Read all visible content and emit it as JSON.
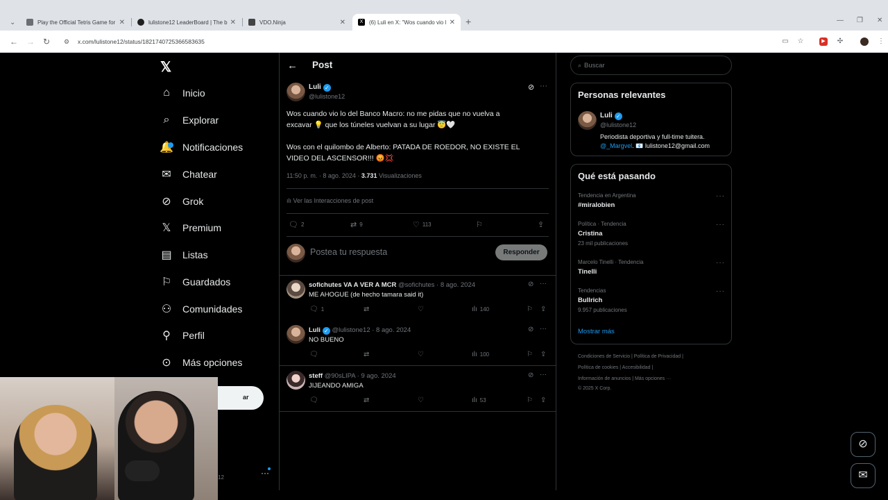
{
  "browser": {
    "tabs": [
      {
        "title": "Play the Official Tetris Game for",
        "color": "#6b6f73"
      },
      {
        "title": "lulistone12 LeaderBoard | The b",
        "color": "#1f1f1f"
      },
      {
        "title": "VDO.Ninja",
        "color": "#444"
      },
      {
        "title": "(6) Luli en X: \"Wos cuando vio l",
        "color": "#000"
      }
    ],
    "url": "x.com/lulistone12/status/1821740725366583635"
  },
  "nav": {
    "items": [
      {
        "label": "Inicio",
        "icon": "home-icon",
        "glyph": "⌂"
      },
      {
        "label": "Explorar",
        "icon": "search-icon",
        "glyph": "⌕"
      },
      {
        "label": "Notificaciones",
        "icon": "bell-icon",
        "glyph": "🔔"
      },
      {
        "label": "Chatear",
        "icon": "mail-icon",
        "glyph": "✉"
      },
      {
        "label": "Grok",
        "icon": "grok-icon",
        "glyph": "⊘"
      },
      {
        "label": "Premium",
        "icon": "x-icon",
        "glyph": "𝕏"
      },
      {
        "label": "Listas",
        "icon": "list-icon",
        "glyph": "▤"
      },
      {
        "label": "Guardados",
        "icon": "bookmark-icon",
        "glyph": "⚐"
      },
      {
        "label": "Comunidades",
        "icon": "people-icon",
        "glyph": "⚇"
      },
      {
        "label": "Perfil",
        "icon": "person-icon",
        "glyph": "⚲"
      },
      {
        "label": "Más opciones",
        "icon": "more-circle-icon",
        "glyph": "⊙"
      }
    ],
    "post_button": "ar",
    "partial_handle": "12"
  },
  "post": {
    "header_title": "Post",
    "author_name": "Luli",
    "author_handle": "@lulistone12",
    "text_line1": "Wos cuando vio lo del Banco Macro: no me pidas que no vuelva a",
    "text_line2": "excavar 💡 que los túneles vuelvan a su lugar 😇🤍",
    "text_line3": "Wos con el quilombo de Alberto: PATADA DE ROEDOR, NO EXISTE EL",
    "text_line4": "VIDEO DEL ASCENSOR!!! 😡💢",
    "time": "11:50 p. m. · 8 ago. 2024 ·",
    "views": "3.731",
    "views_label": "Visualizaciones",
    "interactions": "Ver las Interacciones de post",
    "replies": "2",
    "reposts": "9",
    "likes": "113",
    "reply_placeholder": "Postea tu respuesta",
    "reply_button": "Responder"
  },
  "replies": [
    {
      "name": "sofichutes VA A VER A MCR",
      "handle": "@sofichutes · 8 ago. 2024",
      "text": "ME AHOGUE (de hecho tamara said it)",
      "replies": "1",
      "views": "140"
    },
    {
      "name": "Luli",
      "handle": "@lulistone12 · 8 ago. 2024",
      "text": "NO BUENO",
      "replies": "",
      "views": "100"
    },
    {
      "name": "steff",
      "handle": "@90sLIPA · 9 ago. 2024",
      "text": "JIJEANDO AMIGA",
      "replies": "",
      "views": "53"
    }
  ],
  "sidebar": {
    "search_placeholder": "Buscar",
    "relevant_title": "Personas relevantes",
    "rel_name": "Luli",
    "rel_handle": "@lulistone12",
    "rel_bio1": "Periodista deportiva y full-time tuitera.",
    "rel_bio_link": "@_Margvel",
    "rel_bio2": ". 📧 lulistone12@gmail.com",
    "trending_title": "Qué está pasando",
    "trends": [
      {
        "meta": "Tendencia en Argentina",
        "name": "#miralobien",
        "count": ""
      },
      {
        "meta": "Política · Tendencia",
        "name": "Cristina",
        "count": "23 mil publicaciones"
      },
      {
        "meta": "Marcelo Tinelli · Tendencia",
        "name": "Tinelli",
        "count": ""
      },
      {
        "meta": "Tendencias",
        "name": "Bullrich",
        "count": "9.957 publicaciones"
      }
    ],
    "show_more": "Mostrar más",
    "footer1": "Condiciones de Servicio  |   Política de Privacidad  |",
    "footer2": "Política de cookies  |   Accesibilidad  |",
    "footer3": "Información de anuncios  |   Más opciones ···",
    "footer4": "© 2025 X Corp."
  },
  "colors": {
    "accent": "#1d9bf0",
    "bg": "#000000",
    "text": "#e7e9ea",
    "muted": "#71767b"
  }
}
